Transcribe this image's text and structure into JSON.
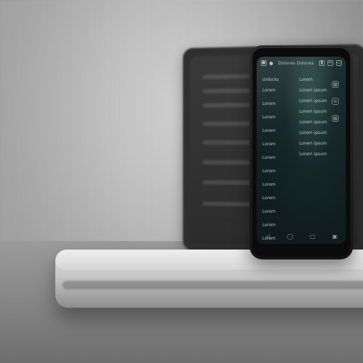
{
  "phone": {
    "status": {
      "left_icons": [
        "camera-icon",
        "circle-icon"
      ],
      "center_text": "Dolores Dolores",
      "right_icons": [
        "signal-icon",
        "wifi-icon",
        "battery-icon"
      ]
    },
    "left_list": [
      "Unlocks",
      "Lorem",
      "Lorem",
      "Lorem",
      "Lorem",
      "Lorem",
      "Lorem",
      "Lorem",
      "Lorem",
      "Lorem",
      "Lorem",
      "Lorem",
      "Lorem"
    ],
    "right_list": [
      "Lorem",
      "Lorem ipsum",
      "Lorem ipsum",
      "Lorem ipsum",
      "Lorem ipsum",
      "Lorem ipsum",
      "Lorem ipsum",
      "Lorem ipsum"
    ],
    "side_icons": [
      "grid-icon",
      "list-icon",
      "grid-icon"
    ],
    "bottom_nav_icons": [
      "back-icon",
      "home-icon",
      "recent-icon",
      "square-icon"
    ]
  }
}
